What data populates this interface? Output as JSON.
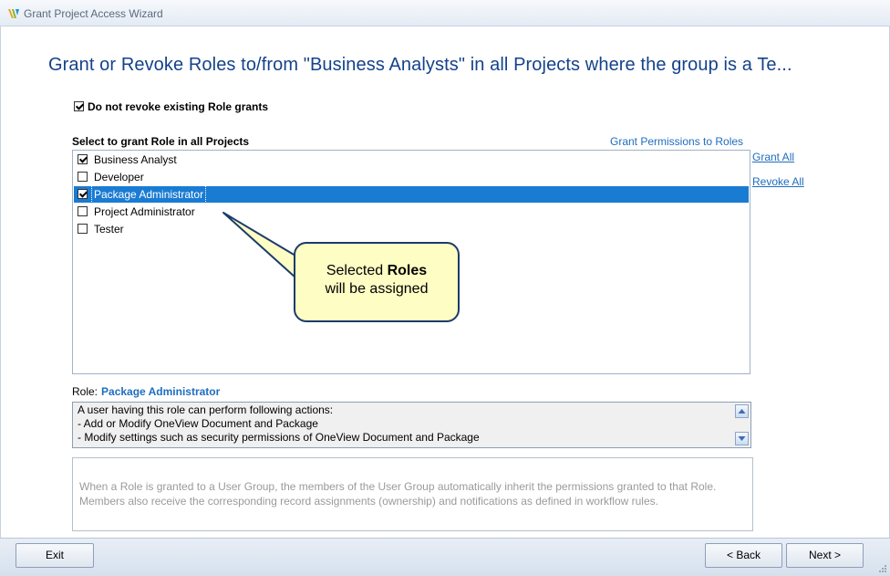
{
  "window": {
    "title": "Grant Project Access Wizard"
  },
  "heading": "Grant or Revoke Roles to/from \"Business Analysts\" in all Projects where the group is a Te...",
  "no_revoke": {
    "label": "Do not revoke existing Role grants",
    "checked": true
  },
  "roles_list": {
    "label": "Select to grant Role in all Projects",
    "items": [
      {
        "label": "Business Analyst",
        "checked": true,
        "selected": false
      },
      {
        "label": "Developer",
        "checked": false,
        "selected": false
      },
      {
        "label": "Package Administrator",
        "checked": true,
        "selected": true
      },
      {
        "label": "Project Administrator",
        "checked": false,
        "selected": false
      },
      {
        "label": "Tester",
        "checked": false,
        "selected": false
      }
    ]
  },
  "links": {
    "grant_permissions": "Grant Permissions to Roles",
    "grant_all": "Grant All",
    "revoke_all": "Revoke All"
  },
  "callout": {
    "prefix": "Selected ",
    "bold": "Roles",
    "line2": "will be assigned"
  },
  "role_detail": {
    "caption": "Role:",
    "name": "Package Administrator",
    "description": [
      "A user having this role can perform following actions:",
      "- Add or Modify OneView Document and Package",
      "- Modify settings such as security permissions of OneView Document and Package"
    ]
  },
  "info_text": [
    "When a Role is granted to a User Group, the members of the User Group automatically inherit the permissions granted to that Role.",
    "Members also receive the corresponding record assignments (ownership) and notifications as defined in workflow rules."
  ],
  "buttons": {
    "exit": "Exit",
    "back": "< Back",
    "next": "Next >"
  },
  "colors": {
    "heading": "#15428b",
    "link": "#1f6dbf",
    "selection": "#1a7bd3",
    "callout_bg": "#fefdc3"
  }
}
